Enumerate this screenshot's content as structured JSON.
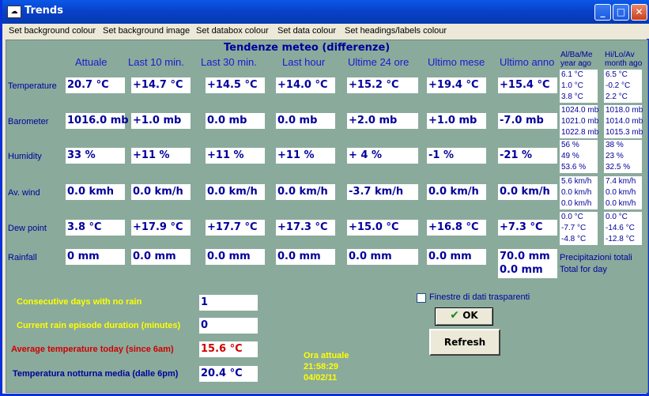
{
  "window": {
    "title": "Trends"
  },
  "menu": [
    {
      "label": "Set background colour"
    },
    {
      "label": "Set background image"
    },
    {
      "label": "Set databox colour"
    },
    {
      "label": "Set data colour"
    },
    {
      "label": "Set headings/labels colour"
    }
  ],
  "main": {
    "heading": "Tendenze meteo (differenze)",
    "columns": [
      "Attuale",
      "Last 10 min.",
      "Last 30 min.",
      "Last hour",
      "Ultime 24 ore",
      "Ultimo mese",
      "Ultimo anno"
    ],
    "side_headers": {
      "year": "Al/Ba/Me\nyear ago",
      "month": "Hi/Lo/Av\nmonth ago"
    },
    "rows": [
      {
        "label": "Temperature",
        "values": [
          "20.7 °C",
          "+14.7 °C",
          "+14.5 °C",
          "+14.0 °C",
          "+15.2 °C",
          "+19.4 °C",
          "+15.4 °C"
        ],
        "year": [
          "6.1 °C",
          "1.0 °C",
          "3.8 °C"
        ],
        "month": [
          "6.5 °C",
          "-0.2 °C",
          "2.2 °C"
        ]
      },
      {
        "label": "Barometer",
        "values": [
          "1016.0 mb",
          "+1.0 mb",
          "0.0 mb",
          "0.0 mb",
          "+2.0 mb",
          "+1.0 mb",
          "-7.0 mb"
        ],
        "year": [
          "1024.0 mb",
          "1021.0 mb",
          "1022.8 mb"
        ],
        "month": [
          "1018.0 mb",
          "1014.0 mb",
          "1015.3 mb"
        ]
      },
      {
        "label": "Humidity",
        "values": [
          "33 %",
          "+11 %",
          "+11 %",
          "+11 %",
          "+ 4 %",
          "-1 %",
          "-21 %"
        ],
        "year": [
          "56 %",
          "49 %",
          "53.6 %"
        ],
        "month": [
          "38 %",
          "23 %",
          "32.5 %"
        ]
      },
      {
        "label": "Av. wind",
        "values": [
          "0.0 kmh",
          "0.0 km/h",
          "0.0 km/h",
          "0.0 km/h",
          "-3.7 km/h",
          "0.0 km/h",
          "0.0 km/h"
        ],
        "year": [
          "5.6 km/h",
          "0.0 km/h",
          "0.0 km/h"
        ],
        "month": [
          "7.4 km/h",
          "0.0 km/h",
          "0.0 km/h"
        ]
      },
      {
        "label": "Dew point",
        "values": [
          "3.8 °C",
          "+17.9 °C",
          "+17.7 °C",
          "+17.3 °C",
          "+15.0 °C",
          "+16.8 °C",
          "+7.3 °C"
        ],
        "year": [
          "0.0 °C",
          "-7.7 °C",
          "-4.8 °C"
        ],
        "month": [
          "0.0 °C",
          "-14.6 °C",
          "-12.8 °C"
        ]
      }
    ],
    "rainfall": {
      "label": "Rainfall",
      "values": [
        " 0 mm",
        "0.0 mm",
        "0.0 mm",
        "0.0 mm",
        "0.0 mm",
        "0.0 mm"
      ],
      "year_values": [
        "70.0 mm",
        "0.0 mm"
      ],
      "note1": "Precipitazioni  totali",
      "note2": "Total for day"
    }
  },
  "stats": [
    {
      "label": "Consecutive days with no rain",
      "value": "1",
      "color": "#ffff00"
    },
    {
      "label": "Current rain episode duration (minutes)",
      "value": "0",
      "color": "#ffff00"
    },
    {
      "label": "Average temperature today (since 6am)",
      "value": "15.6 °C",
      "color": "#d00000"
    },
    {
      "label": "Temperatura notturna media (dalle 6pm)",
      "value": "20.4 °C",
      "color": "#00009a"
    }
  ],
  "clock": {
    "label": "Ora attuale",
    "time": "21:58:29",
    "date": "04/02/11"
  },
  "transparent_checkbox": {
    "label": "Finestre di dati trasparenti",
    "checked": false
  },
  "buttons": {
    "ok": "OK",
    "refresh": "Refresh"
  },
  "colors": {
    "panel": "#8aaa9c",
    "data_text": "#00009a",
    "stat_yellow": "#ffff00",
    "stat_red": "#d00000"
  }
}
